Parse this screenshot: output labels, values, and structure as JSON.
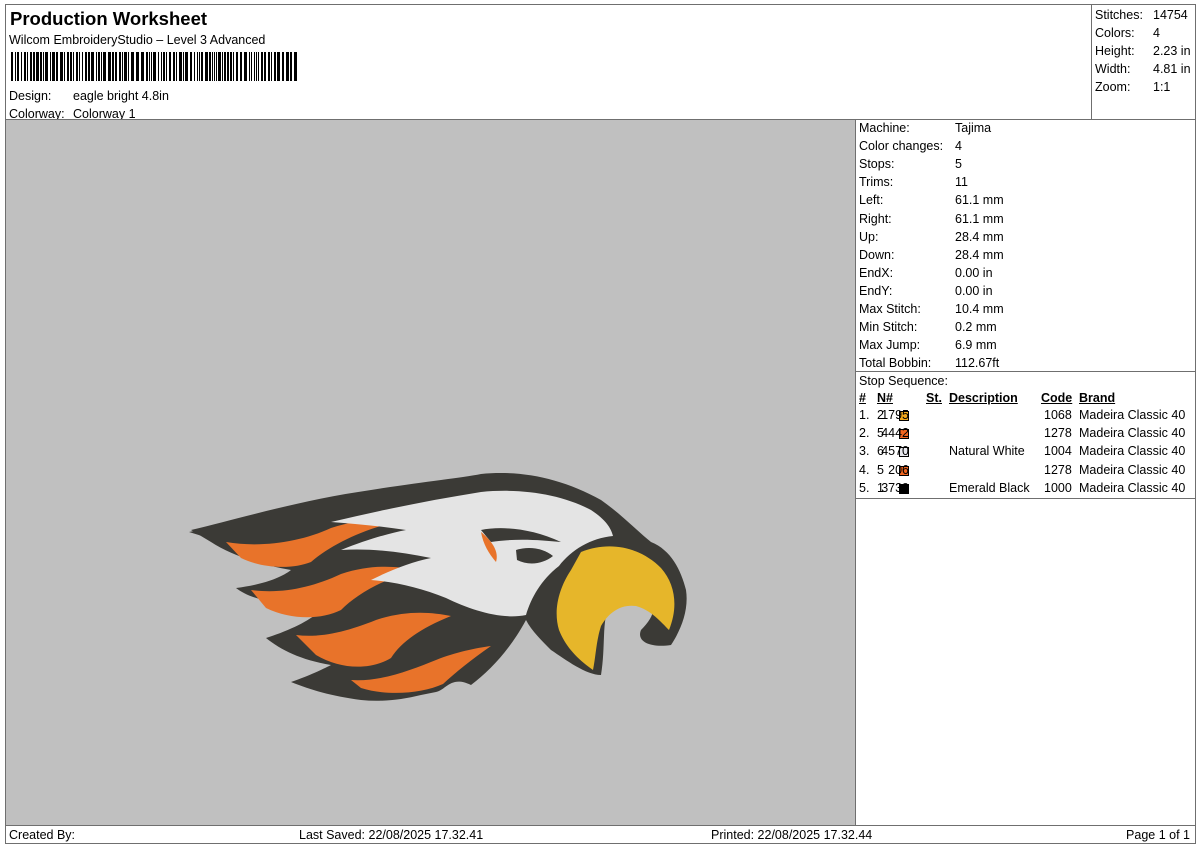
{
  "header": {
    "title": "Production Worksheet",
    "software": "Wilcom EmbroideryStudio – Level 3 Advanced",
    "design_label": "Design:",
    "design_value": "eagle bright 4.8in",
    "colorway_label": "Colorway:",
    "colorway_value": "Colorway 1"
  },
  "summary": [
    {
      "label": "Stitches:",
      "value": "14754"
    },
    {
      "label": "Colors:",
      "value": "4"
    },
    {
      "label": "Height:",
      "value": "2.23 in"
    },
    {
      "label": "Width:",
      "value": "4.81 in"
    },
    {
      "label": "Zoom:",
      "value": "1:1"
    }
  ],
  "machine_info": [
    {
      "label": "Machine:",
      "value": "Tajima"
    },
    {
      "label": "Color changes:",
      "value": "4"
    },
    {
      "label": "Stops:",
      "value": "5"
    },
    {
      "label": "Trims:",
      "value": "11"
    },
    {
      "label": "Left:",
      "value": "61.1 mm"
    },
    {
      "label": "Right:",
      "value": "61.1 mm"
    },
    {
      "label": "Up:",
      "value": "28.4 mm"
    },
    {
      "label": "Down:",
      "value": "28.4 mm"
    },
    {
      "label": "EndX:",
      "value": "0.00 in"
    },
    {
      "label": "EndY:",
      "value": "0.00 in"
    },
    {
      "label": "Max Stitch:",
      "value": "10.4 mm"
    },
    {
      "label": "Min Stitch:",
      "value": "0.2 mm"
    },
    {
      "label": "Max Jump:",
      "value": "6.9 mm"
    },
    {
      "label": "Total Bobbin:",
      "value": "112.67ft"
    }
  ],
  "stop_sequence": {
    "title": "Stop Sequence:",
    "headers": {
      "num": "#",
      "n": "N#",
      "st": "St.",
      "description": "Description",
      "code": "Code",
      "brand": "Brand"
    },
    "rows": [
      {
        "num": "1.",
        "n": "2",
        "color": "#f2a81c",
        "st": "1795",
        "description": "",
        "code": "1068",
        "brand": "Madeira Classic 40"
      },
      {
        "num": "2.",
        "n": "5",
        "color": "#f0641e",
        "st": "4442",
        "description": "",
        "code": "1278",
        "brand": "Madeira Classic 40"
      },
      {
        "num": "3.",
        "n": "6",
        "color": "#e8e8ee",
        "st": "4570",
        "description": "Natural White",
        "code": "1004",
        "brand": "Madeira Classic 40"
      },
      {
        "num": "4.",
        "n": "5",
        "color": "#f0641e",
        "st": "206",
        "description": "",
        "code": "1278",
        "brand": "Madeira Classic 40"
      },
      {
        "num": "5.",
        "n": "1",
        "color": "#000000",
        "st": "3739",
        "description": "Emerald Black",
        "code": "1000",
        "brand": "Madeira Classic 40"
      }
    ]
  },
  "footer": {
    "created_by": "Created By:",
    "last_saved": "Last Saved: 22/08/2025 17.32.41",
    "printed": "Printed: 22/08/2025 17.32.44",
    "page": "Page 1 of 1"
  },
  "preview": {
    "background_color": "#c0c0c0",
    "design_colors": {
      "outline": "#3b3a36",
      "orange": "#e8732a",
      "white": "#e4e4e4",
      "yellow": "#e6b62a"
    }
  }
}
